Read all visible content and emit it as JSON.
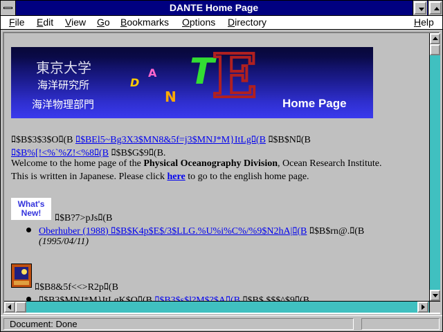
{
  "window": {
    "title": "DANTE Home Page"
  },
  "menubar": {
    "items": [
      "File",
      "Edit",
      "View",
      "Go",
      "Bookmarks",
      "Options",
      "Directory",
      "Help"
    ]
  },
  "banner": {
    "jp_line1": "東京大学",
    "jp_line2": "海洋研究所",
    "jp_line3": "海洋物理部門",
    "logo_letters": [
      "D",
      "A",
      "N",
      "T",
      "E"
    ],
    "home_label": "Home Page"
  },
  "content": {
    "line1_a": "ﾛ$B$3$3$Oﾛ(B ",
    "line1_link": "ﾛ$BEl5~Bg3X3$MN8&5f=j3$MNJ*M}ItLgﾛ(B",
    "line1_b": " ﾛ$B$Nﾛ(B",
    "line2_link": "ﾛ$B%[!<%`%Z!<%8ﾛ(B",
    "line2_b": " ﾛ$B$G$9ﾛ(B.",
    "welcome_pre": "Welcome to the home page of the ",
    "welcome_bold": "Physical Oceanography Division",
    "welcome_post": ", Ocean Research Institute.",
    "english_pre": "This is written in Japanese. Please click ",
    "english_link": "here",
    "english_post": " to go to the english home page.",
    "whats_new_line1": "What's",
    "whats_new_line2": "New!",
    "whats_new_heading": "ﾛ$B?7>pJsﾛ(B",
    "news_item_link": "Oberhuber (1988) ﾛ$B$K4p$E$/3$LLG.%U%i%C%/%9$N2hA|ﾛ(B",
    "news_item_after": " ﾛ$B$rn@.ﾛ(B",
    "news_item_date": "(1995/04/11)",
    "section2_heading": "ﾛ$B8&5f<<>R2pﾛ(B",
    "section2_item_a": "ﾛ$B3$MNJ*M}ItLgK$Oﾛ(B ",
    "section2_item_link": "ﾛ$B3$s$l?M$?$Aﾛ(B",
    "section2_item_b": " ﾛ$B$.$$$^$9ﾛ(B"
  },
  "statusbar": {
    "text": "Document: Done"
  },
  "icons": {
    "system_menu": "system-menu-icon",
    "minimize": "minimize-icon",
    "maximize": "maximize-icon"
  },
  "colors": {
    "titlebar": "#000080",
    "link": "#0000ee",
    "scrollbar": "#40c0c0"
  }
}
